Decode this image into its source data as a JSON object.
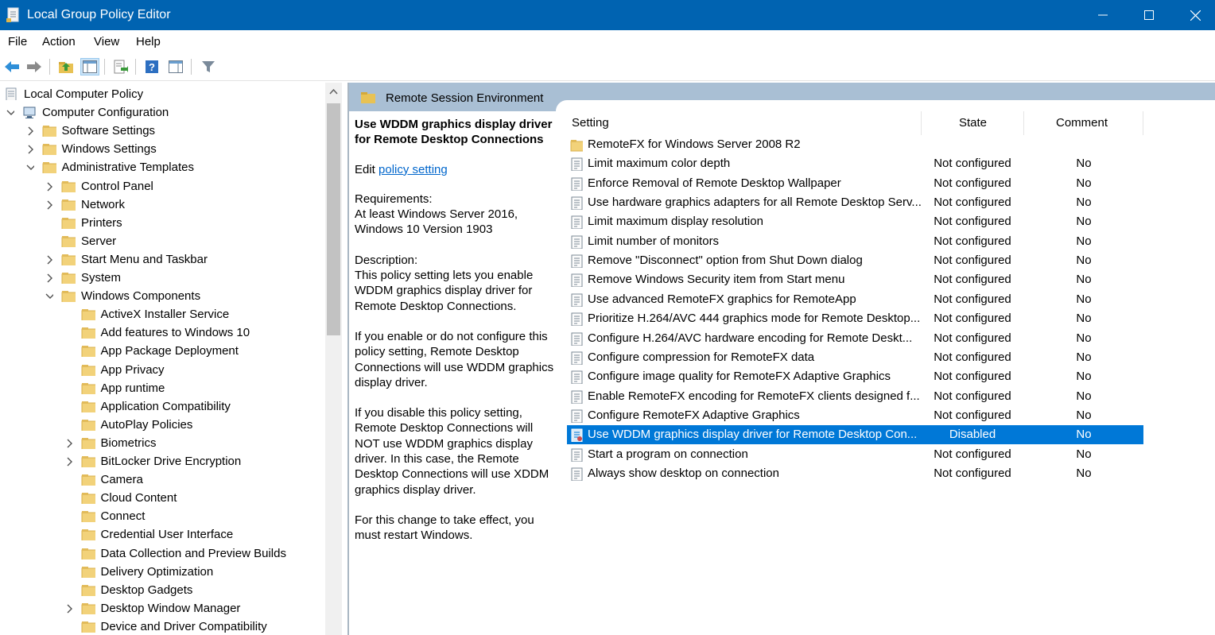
{
  "window": {
    "title": "Local Group Policy Editor"
  },
  "menu": [
    "File",
    "Action",
    "View",
    "Help"
  ],
  "colors": {
    "titlebar": "#0063b1",
    "selection": "#0078d7",
    "header_band": "#a9bfd4",
    "link": "#0066cc"
  },
  "tree": [
    {
      "label": "Local Computer Policy",
      "icon": "policy-doc-icon",
      "expander": ""
    },
    {
      "label": "Computer Configuration",
      "icon": "computer-icon",
      "expander": "expanded"
    },
    {
      "label": "Software Settings",
      "icon": "folder-icon",
      "expander": "collapsed"
    },
    {
      "label": "Windows Settings",
      "icon": "folder-icon",
      "expander": "collapsed"
    },
    {
      "label": "Administrative Templates",
      "icon": "folder-icon",
      "expander": "expanded"
    },
    {
      "label": "Control Panel",
      "icon": "folder-icon",
      "expander": "collapsed"
    },
    {
      "label": "Network",
      "icon": "folder-icon",
      "expander": "collapsed"
    },
    {
      "label": "Printers",
      "icon": "folder-icon",
      "expander": ""
    },
    {
      "label": "Server",
      "icon": "folder-icon",
      "expander": ""
    },
    {
      "label": "Start Menu and Taskbar",
      "icon": "folder-icon",
      "expander": "collapsed"
    },
    {
      "label": "System",
      "icon": "folder-icon",
      "expander": "collapsed"
    },
    {
      "label": "Windows Components",
      "icon": "folder-icon",
      "expander": "expanded"
    },
    {
      "label": "ActiveX Installer Service",
      "icon": "folder-icon",
      "expander": ""
    },
    {
      "label": "Add features to Windows 10",
      "icon": "folder-icon",
      "expander": ""
    },
    {
      "label": "App Package Deployment",
      "icon": "folder-icon",
      "expander": ""
    },
    {
      "label": "App Privacy",
      "icon": "folder-icon",
      "expander": ""
    },
    {
      "label": "App runtime",
      "icon": "folder-icon",
      "expander": ""
    },
    {
      "label": "Application Compatibility",
      "icon": "folder-icon",
      "expander": ""
    },
    {
      "label": "AutoPlay Policies",
      "icon": "folder-icon",
      "expander": ""
    },
    {
      "label": "Biometrics",
      "icon": "folder-icon",
      "expander": "collapsed"
    },
    {
      "label": "BitLocker Drive Encryption",
      "icon": "folder-icon",
      "expander": "collapsed"
    },
    {
      "label": "Camera",
      "icon": "folder-icon",
      "expander": ""
    },
    {
      "label": "Cloud Content",
      "icon": "folder-icon",
      "expander": ""
    },
    {
      "label": "Connect",
      "icon": "folder-icon",
      "expander": ""
    },
    {
      "label": "Credential User Interface",
      "icon": "folder-icon",
      "expander": ""
    },
    {
      "label": "Data Collection and Preview Builds",
      "icon": "folder-icon",
      "expander": ""
    },
    {
      "label": "Delivery Optimization",
      "icon": "folder-icon",
      "expander": ""
    },
    {
      "label": "Desktop Gadgets",
      "icon": "folder-icon",
      "expander": ""
    },
    {
      "label": "Desktop Window Manager",
      "icon": "folder-icon",
      "expander": "collapsed"
    },
    {
      "label": "Device and Driver Compatibility",
      "icon": "folder-icon",
      "expander": ""
    }
  ],
  "panel": {
    "title": "Remote Session Environment",
    "description": {
      "heading": "Use WDDM graphics display driver for Remote Desktop Connections",
      "edit_prefix": "Edit ",
      "edit_link": "policy setting",
      "requirements": [
        "Requirements:",
        "At least Windows Server 2016,",
        "Windows 10 Version 1903"
      ],
      "description": [
        "Description:",
        "This policy setting lets you enable",
        "WDDM graphics display driver for",
        "Remote Desktop Connections."
      ],
      "enable_text": [
        "If you enable or do not configure this",
        "policy setting, Remote Desktop",
        "Connections will use WDDM graphics",
        "display driver."
      ],
      "disable_text": [
        "If you disable this policy setting,",
        "Remote Desktop Connections will",
        "NOT use WDDM graphics display",
        "driver. In this case, the Remote",
        "Desktop Connections will use XDDM",
        "graphics display driver."
      ],
      "restart_text": [
        "For this change to take effect, you",
        "must restart Windows."
      ]
    },
    "columns": {
      "setting": "Setting",
      "state": "State",
      "comment": "Comment"
    },
    "rows": [
      {
        "name": "RemoteFX for Windows Server 2008 R2",
        "state": "",
        "comment": "",
        "icon": "folder-icon",
        "selected": false
      },
      {
        "name": "Limit maximum color depth",
        "state": "Not configured",
        "comment": "No",
        "icon": "setting-icon",
        "selected": false
      },
      {
        "name": "Enforce Removal of Remote Desktop Wallpaper",
        "state": "Not configured",
        "comment": "No",
        "icon": "setting-icon",
        "selected": false
      },
      {
        "name": "Use hardware graphics adapters for all Remote Desktop Serv...",
        "state": "Not configured",
        "comment": "No",
        "icon": "setting-icon",
        "selected": false
      },
      {
        "name": "Limit maximum display resolution",
        "state": "Not configured",
        "comment": "No",
        "icon": "setting-icon",
        "selected": false
      },
      {
        "name": "Limit number of monitors",
        "state": "Not configured",
        "comment": "No",
        "icon": "setting-icon",
        "selected": false
      },
      {
        "name": "Remove \"Disconnect\" option from Shut Down dialog",
        "state": "Not configured",
        "comment": "No",
        "icon": "setting-icon",
        "selected": false
      },
      {
        "name": "Remove Windows Security item from Start menu",
        "state": "Not configured",
        "comment": "No",
        "icon": "setting-icon",
        "selected": false
      },
      {
        "name": "Use advanced RemoteFX graphics for RemoteApp",
        "state": "Not configured",
        "comment": "No",
        "icon": "setting-icon",
        "selected": false
      },
      {
        "name": "Prioritize H.264/AVC 444 graphics mode for Remote Desktop...",
        "state": "Not configured",
        "comment": "No",
        "icon": "setting-icon",
        "selected": false
      },
      {
        "name": "Configure H.264/AVC hardware encoding for Remote Deskt...",
        "state": "Not configured",
        "comment": "No",
        "icon": "setting-icon",
        "selected": false
      },
      {
        "name": "Configure compression for RemoteFX data",
        "state": "Not configured",
        "comment": "No",
        "icon": "setting-icon",
        "selected": false
      },
      {
        "name": "Configure image quality for RemoteFX Adaptive Graphics",
        "state": "Not configured",
        "comment": "No",
        "icon": "setting-icon",
        "selected": false
      },
      {
        "name": "Enable RemoteFX encoding for RemoteFX clients designed f...",
        "state": "Not configured",
        "comment": "No",
        "icon": "setting-icon",
        "selected": false
      },
      {
        "name": "Configure RemoteFX Adaptive Graphics",
        "state": "Not configured",
        "comment": "No",
        "icon": "setting-icon",
        "selected": false
      },
      {
        "name": "Use WDDM graphics display driver for Remote Desktop Con...",
        "state": "Disabled",
        "comment": "No",
        "icon": "setting-icon",
        "selected": true
      },
      {
        "name": "Start a program on connection",
        "state": "Not configured",
        "comment": "No",
        "icon": "setting-icon",
        "selected": false
      },
      {
        "name": "Always show desktop on connection",
        "state": "Not configured",
        "comment": "No",
        "icon": "setting-icon",
        "selected": false
      }
    ]
  }
}
